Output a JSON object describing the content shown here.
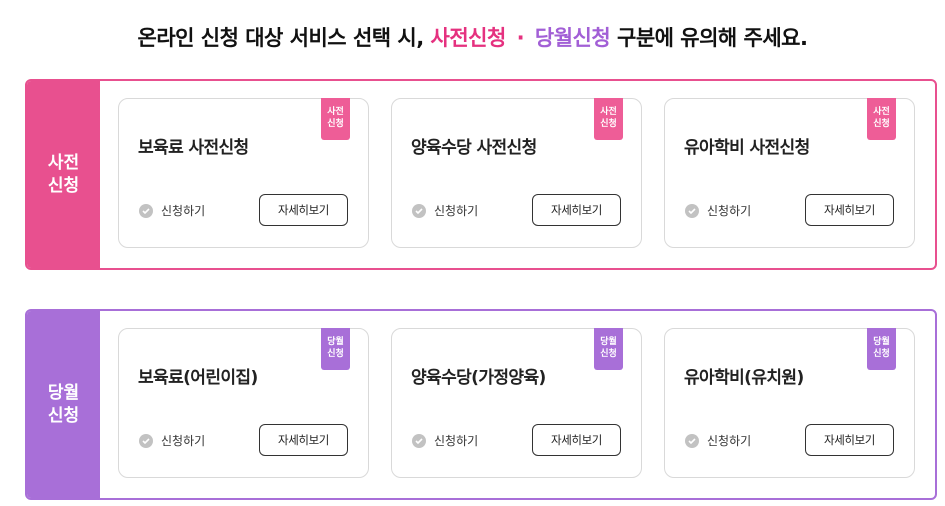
{
  "headline": {
    "part1": "온라인 신청 대상 서비스 선택 시,",
    "pre": "사전신청",
    "dot": "·",
    "cur": "당월신청",
    "part2": "구분에 유의해 주세요."
  },
  "colors": {
    "pre": "#e8508f",
    "cur": "#a86fd8"
  },
  "groups": [
    {
      "label": "사전\n신청",
      "cards": [
        {
          "badge": "사전\n신청",
          "title": "보육료 사전신청",
          "apply": "신청하기",
          "detail": "자세히보기"
        },
        {
          "badge": "사전\n신청",
          "title": "양육수당 사전신청",
          "apply": "신청하기",
          "detail": "자세히보기"
        },
        {
          "badge": "사전\n신청",
          "title": "유아학비 사전신청",
          "apply": "신청하기",
          "detail": "자세히보기"
        }
      ]
    },
    {
      "label": "당월\n신청",
      "cards": [
        {
          "badge": "당월\n신청",
          "title": "보육료(어린이집)",
          "apply": "신청하기",
          "detail": "자세히보기"
        },
        {
          "badge": "당월\n신청",
          "title": "양육수당(가정양육)",
          "apply": "신청하기",
          "detail": "자세히보기"
        },
        {
          "badge": "당월\n신청",
          "title": "유아학비(유치원)",
          "apply": "신청하기",
          "detail": "자세히보기"
        }
      ]
    }
  ]
}
